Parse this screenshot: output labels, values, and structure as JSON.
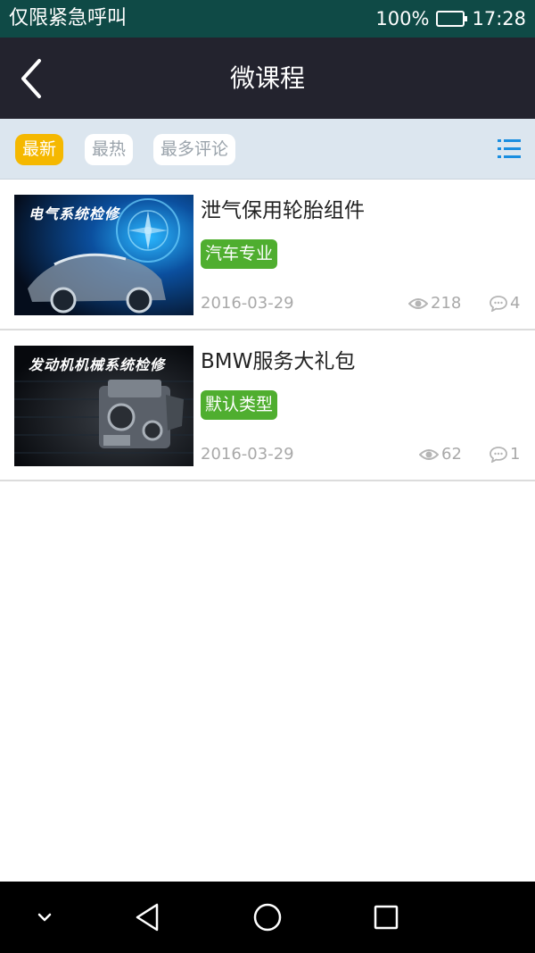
{
  "status_bar": {
    "carrier": "仅限紧急呼叫",
    "battery_percent": "100%",
    "battery_level": 1.0,
    "time": "17:28"
  },
  "nav": {
    "title": "微课程",
    "back_icon": "chevron-left-icon"
  },
  "filters": {
    "tabs": [
      {
        "label": "最新",
        "selected": true
      },
      {
        "label": "最热",
        "selected": false
      },
      {
        "label": "最多评论",
        "selected": false
      }
    ],
    "list_view_icon": "list-icon"
  },
  "courses": [
    {
      "thumbnail_caption": "电气系统检修",
      "title": "泄气保用轮胎组件",
      "tag": "汽车专业",
      "date": "2016-03-29",
      "views": "218",
      "comments": "4"
    },
    {
      "thumbnail_caption": "发动机机械系统检修",
      "title": "BMW服务大礼包",
      "tag": "默认类型",
      "date": "2016-03-29",
      "views": "62",
      "comments": "1"
    }
  ],
  "colors": {
    "status_bar": "#0f4a46",
    "nav_bar": "#23232e",
    "filter_bar": "#dce6ef",
    "chip_active": "#f5b800",
    "tag_green": "#4fae2f",
    "list_icon_blue": "#1a8ee0"
  },
  "system_nav": {
    "icons": [
      "chevron-down-icon",
      "back-triangle-icon",
      "home-circle-icon",
      "recents-square-icon"
    ]
  }
}
